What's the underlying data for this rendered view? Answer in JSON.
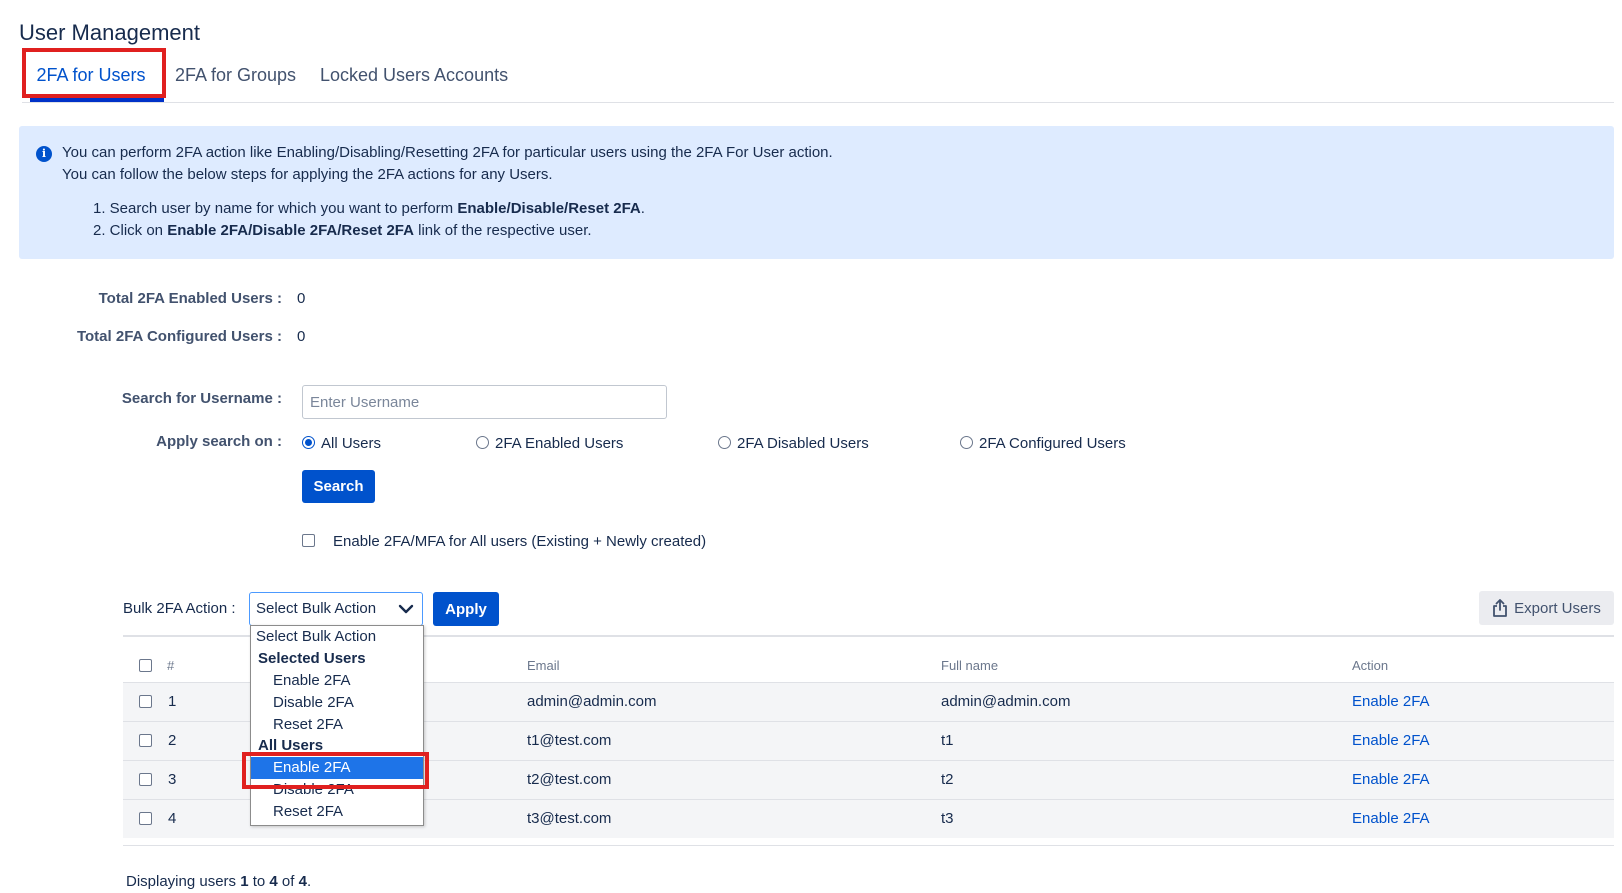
{
  "page": {
    "title": "User Management"
  },
  "tabs": [
    {
      "label": "2FA for Users",
      "active": true
    },
    {
      "label": "2FA for Groups",
      "active": false
    },
    {
      "label": "Locked Users Accounts",
      "active": false
    }
  ],
  "info": {
    "icon": "info-icon",
    "line1": "You can perform 2FA action like Enabling/Disabling/Resetting 2FA for particular users using the 2FA For User action.",
    "line2": "You can follow the below steps for applying the 2FA actions for any Users.",
    "step1_prefix": "1. Search user by name for which you want to perform ",
    "step1_bold": "Enable/Disable/Reset 2FA",
    "step1_suffix": ".",
    "step2_prefix": "2. Click on ",
    "step2_bold": "Enable 2FA/Disable 2FA/Reset 2FA",
    "step2_suffix": " link of the respective user."
  },
  "stats": {
    "enabled_label": "Total 2FA Enabled Users :",
    "enabled_value": "0",
    "configured_label": "Total 2FA Configured Users :",
    "configured_value": "0"
  },
  "search": {
    "label": "Search for Username :",
    "placeholder": "Enter Username",
    "value": "",
    "apply_label": "Apply search on :",
    "options": [
      "All Users",
      "2FA Enabled Users",
      "2FA Disabled Users",
      "2FA Configured Users"
    ],
    "selected": "All Users",
    "button": "Search"
  },
  "enable_all": {
    "label": "Enable 2FA/MFA for All users (Existing + Newly created)",
    "checked": false
  },
  "bulk": {
    "label": "Bulk 2FA Action :",
    "selected": "Select Bulk Action",
    "apply": "Apply",
    "options": {
      "placeholder": "Select Bulk Action",
      "group1": "Selected Users",
      "group1_items": [
        "Enable 2FA",
        "Disable 2FA",
        "Reset 2FA"
      ],
      "group2": "All Users",
      "group2_items": [
        "Enable 2FA",
        "Disable 2FA",
        "Reset 2FA"
      ],
      "highlighted": "All Users / Enable 2FA"
    }
  },
  "export": {
    "label": "Export Users",
    "icon": "export-icon"
  },
  "table": {
    "headers": [
      "#",
      "Email",
      "Full name",
      "Action"
    ],
    "rows": [
      {
        "num": "1",
        "email": "admin@admin.com",
        "fullname": "admin@admin.com",
        "action": "Enable 2FA"
      },
      {
        "num": "2",
        "email": "t1@test.com",
        "fullname": "t1",
        "action": "Enable 2FA"
      },
      {
        "num": "3",
        "email": "t2@test.com",
        "fullname": "t2",
        "action": "Enable 2FA"
      },
      {
        "num": "4",
        "email": "t3@test.com",
        "fullname": "t3",
        "action": "Enable 2FA"
      }
    ]
  },
  "footer": {
    "prefix": "Displaying users ",
    "from": "1",
    "mid": " to ",
    "to": "4",
    "of": " of ",
    "total": "4",
    "end": "."
  },
  "colors": {
    "primary": "#0052cc",
    "highlight": "#e0201f",
    "info_bg": "#deebff",
    "selected_option": "#1e74e8"
  }
}
